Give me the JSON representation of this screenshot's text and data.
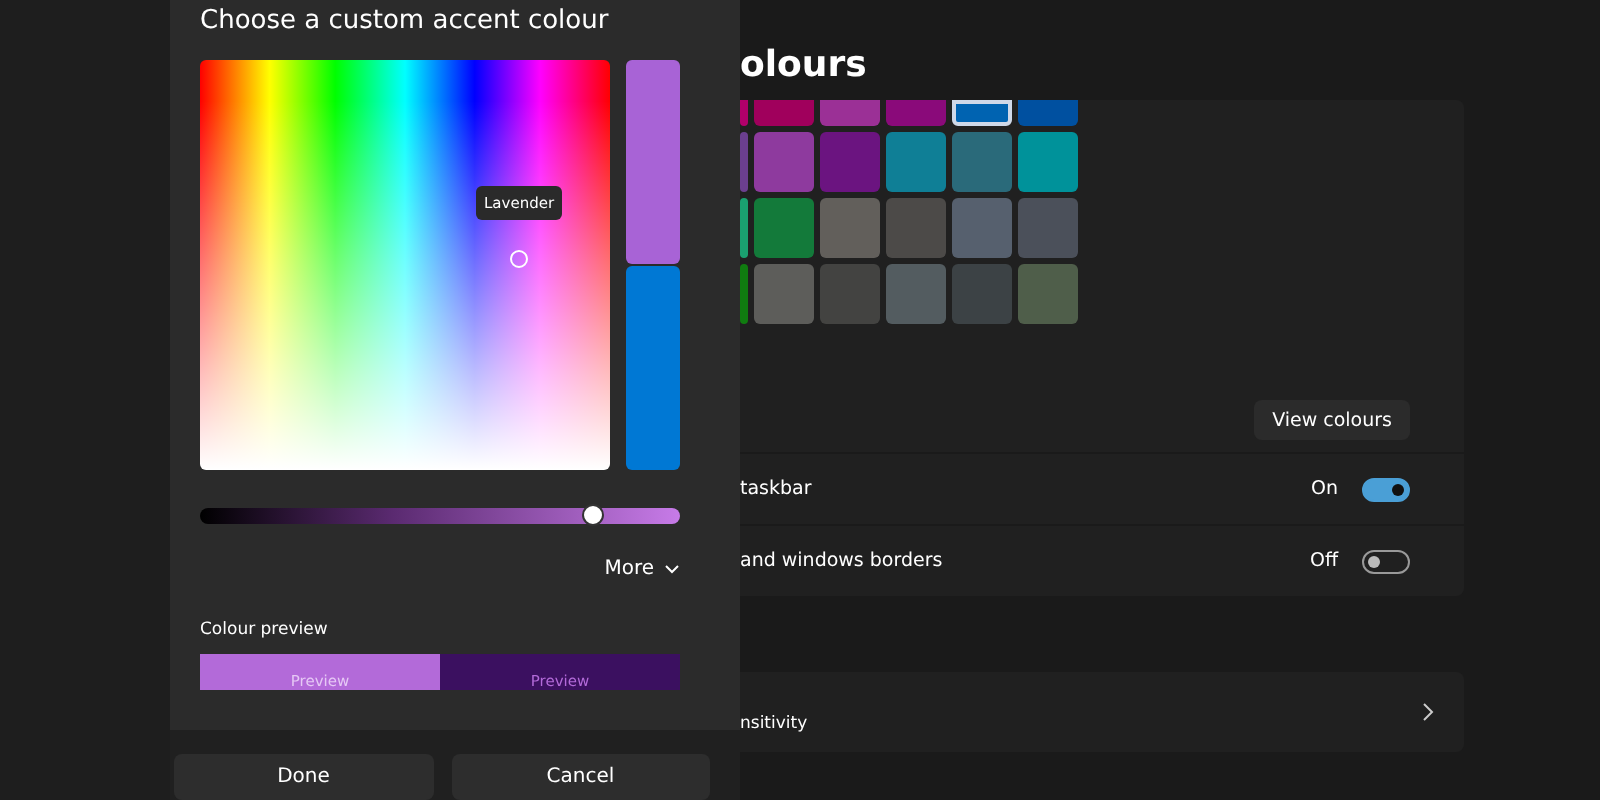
{
  "dialog": {
    "title": "Choose a custom accent colour",
    "picker": {
      "tooltip": "Lavender"
    },
    "brightness": {
      "level": 0.82
    },
    "more_button": "More",
    "preview_label": "Colour preview",
    "previews": [
      {
        "label": "Preview",
        "color": "#b36ad9"
      },
      {
        "label": "Preview",
        "color": "#3b1060"
      }
    ],
    "buttons": [
      "Done",
      "Cancel"
    ]
  },
  "settings": {
    "heading": "olours",
    "swatch_rows": [
      {
        "swatches": [
          {
            "color": "#b0006a",
            "selected": false
          },
          {
            "color": "#a0005c",
            "selected": false
          },
          {
            "color": "#9b3096",
            "selected": false
          },
          {
            "color": "#8a0a7a",
            "selected": false
          },
          {
            "color": "#0063b1",
            "selected": true
          },
          {
            "color": "#0050a0",
            "selected": false
          }
        ]
      },
      {
        "swatches": [
          {
            "color": "#6b3f8f",
            "selected": false
          },
          {
            "color": "#8e3a9e",
            "selected": false
          },
          {
            "color": "#6b1480",
            "selected": false
          },
          {
            "color": "#0f7f96",
            "selected": false
          },
          {
            "color": "#2a6a7a",
            "selected": false
          },
          {
            "color": "#00929a",
            "selected": false
          }
        ]
      },
      {
        "swatches": [
          {
            "color": "#1aa070",
            "selected": false
          },
          {
            "color": "#137a3a",
            "selected": false
          },
          {
            "color": "#625f5b",
            "selected": false
          },
          {
            "color": "#4c4a48",
            "selected": false
          },
          {
            "color": "#56606e",
            "selected": false
          },
          {
            "color": "#4b505a",
            "selected": false
          }
        ]
      },
      {
        "swatches": [
          {
            "color": "#107c10",
            "selected": false
          },
          {
            "color": "#5d5d5a",
            "selected": false
          },
          {
            "color": "#434341",
            "selected": false
          },
          {
            "color": "#535c60",
            "selected": false
          },
          {
            "color": "#3c4245",
            "selected": false
          },
          {
            "color": "#4f5e4a",
            "selected": false
          }
        ]
      }
    ],
    "view_button": "View colours",
    "toggles": [
      {
        "label": "taskbar",
        "state": "On",
        "on": true
      },
      {
        "label": "and windows borders",
        "state": "Off",
        "on": false
      }
    ],
    "link_row": {
      "label": "nsitivity"
    }
  }
}
